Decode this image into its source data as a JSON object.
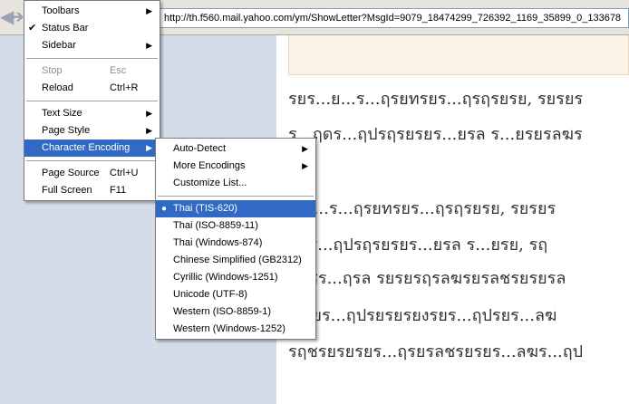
{
  "browser": {
    "url": "http://th.f560.mail.yahoo.com/ym/ShowLetter?MsgId=9079_18474299_726392_1169_35899_0_133678"
  },
  "main_menu": {
    "items": [
      {
        "label": "Toolbars",
        "arrow": "▶"
      },
      {
        "label": "Status Bar",
        "check": "✔"
      },
      {
        "label": "Sidebar",
        "arrow": "▶"
      },
      {
        "label": "Stop",
        "shortcut": "Esc"
      },
      {
        "label": "Reload",
        "shortcut": "Ctrl+R"
      },
      {
        "label": "Text Size",
        "arrow": "▶"
      },
      {
        "label": "Page Style",
        "arrow": "▶"
      },
      {
        "label": "Character Encoding",
        "arrow": "▶"
      },
      {
        "label": "Page Source",
        "shortcut": "Ctrl+U"
      },
      {
        "label": "Full Screen",
        "shortcut": "F11"
      }
    ]
  },
  "encoding_menu": {
    "items": [
      {
        "label": "Auto-Detect",
        "arrow": "▶"
      },
      {
        "label": "More Encodings",
        "arrow": "▶"
      },
      {
        "label": "Customize List..."
      },
      {
        "label": "Thai (TIS-620)",
        "bullet": "●"
      },
      {
        "label": "Thai (ISO-8859-11)"
      },
      {
        "label": "Thai (Windows-874)"
      },
      {
        "label": "Chinese Simplified (GB2312)"
      },
      {
        "label": "Cyrillic (Windows-1251)"
      },
      {
        "label": "Unicode (UTF-8)"
      },
      {
        "label": "Western (ISO-8859-1)"
      },
      {
        "label": "Western (Windows-1252)"
      }
    ]
  },
  "content": {
    "lines": [
      "รยร...ย...ร...ฤรยทรยร...ฤรฤรยรย, รยรยร",
      "ร...ฤดร...ฤปรฤรยรยร...ยรล ร...ยรยรลฆร",
      "...ย...ร...ฤรยทรยร...ฤรฤรยรย, รยรยร",
      "ฤดร...ฤปรฤรยรยร...ยรล ร...ยรย, รฤ",
      "รลชร...ฤรล รยรยรฤรลฆรยรลชรยรยรล",
      "ล รยร...ฤปรยรยรยงรยร...ฤปรยร...ลฆ",
      "รฤชรยรยรยร...ฤรยรลชรยรยร...ลฆร...ฤป"
    ]
  }
}
